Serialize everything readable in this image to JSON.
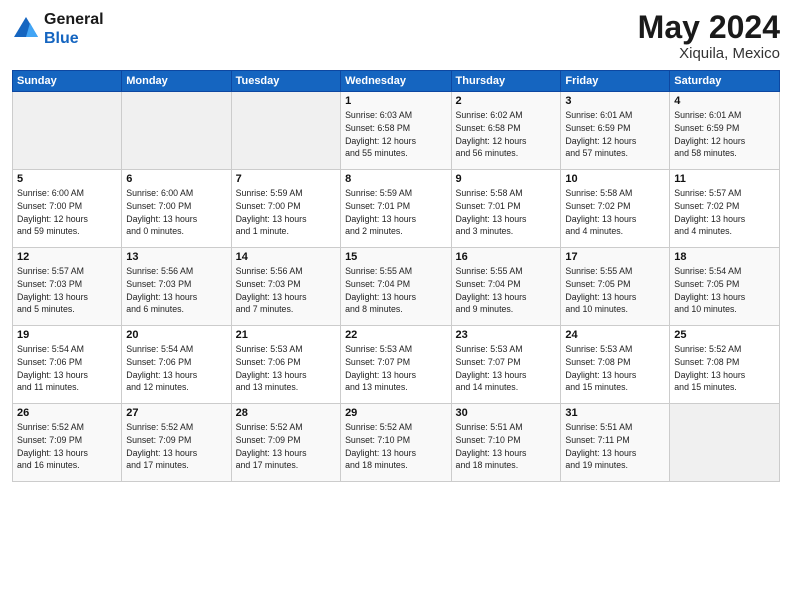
{
  "logo": {
    "line1": "General",
    "line2": "Blue"
  },
  "title": "May 2024",
  "location": "Xiquila, Mexico",
  "days_header": [
    "Sunday",
    "Monday",
    "Tuesday",
    "Wednesday",
    "Thursday",
    "Friday",
    "Saturday"
  ],
  "weeks": [
    [
      {
        "num": "",
        "info": ""
      },
      {
        "num": "",
        "info": ""
      },
      {
        "num": "",
        "info": ""
      },
      {
        "num": "1",
        "info": "Sunrise: 6:03 AM\nSunset: 6:58 PM\nDaylight: 12 hours\nand 55 minutes."
      },
      {
        "num": "2",
        "info": "Sunrise: 6:02 AM\nSunset: 6:58 PM\nDaylight: 12 hours\nand 56 minutes."
      },
      {
        "num": "3",
        "info": "Sunrise: 6:01 AM\nSunset: 6:59 PM\nDaylight: 12 hours\nand 57 minutes."
      },
      {
        "num": "4",
        "info": "Sunrise: 6:01 AM\nSunset: 6:59 PM\nDaylight: 12 hours\nand 58 minutes."
      }
    ],
    [
      {
        "num": "5",
        "info": "Sunrise: 6:00 AM\nSunset: 7:00 PM\nDaylight: 12 hours\nand 59 minutes."
      },
      {
        "num": "6",
        "info": "Sunrise: 6:00 AM\nSunset: 7:00 PM\nDaylight: 13 hours\nand 0 minutes."
      },
      {
        "num": "7",
        "info": "Sunrise: 5:59 AM\nSunset: 7:00 PM\nDaylight: 13 hours\nand 1 minute."
      },
      {
        "num": "8",
        "info": "Sunrise: 5:59 AM\nSunset: 7:01 PM\nDaylight: 13 hours\nand 2 minutes."
      },
      {
        "num": "9",
        "info": "Sunrise: 5:58 AM\nSunset: 7:01 PM\nDaylight: 13 hours\nand 3 minutes."
      },
      {
        "num": "10",
        "info": "Sunrise: 5:58 AM\nSunset: 7:02 PM\nDaylight: 13 hours\nand 4 minutes."
      },
      {
        "num": "11",
        "info": "Sunrise: 5:57 AM\nSunset: 7:02 PM\nDaylight: 13 hours\nand 4 minutes."
      }
    ],
    [
      {
        "num": "12",
        "info": "Sunrise: 5:57 AM\nSunset: 7:03 PM\nDaylight: 13 hours\nand 5 minutes."
      },
      {
        "num": "13",
        "info": "Sunrise: 5:56 AM\nSunset: 7:03 PM\nDaylight: 13 hours\nand 6 minutes."
      },
      {
        "num": "14",
        "info": "Sunrise: 5:56 AM\nSunset: 7:03 PM\nDaylight: 13 hours\nand 7 minutes."
      },
      {
        "num": "15",
        "info": "Sunrise: 5:55 AM\nSunset: 7:04 PM\nDaylight: 13 hours\nand 8 minutes."
      },
      {
        "num": "16",
        "info": "Sunrise: 5:55 AM\nSunset: 7:04 PM\nDaylight: 13 hours\nand 9 minutes."
      },
      {
        "num": "17",
        "info": "Sunrise: 5:55 AM\nSunset: 7:05 PM\nDaylight: 13 hours\nand 10 minutes."
      },
      {
        "num": "18",
        "info": "Sunrise: 5:54 AM\nSunset: 7:05 PM\nDaylight: 13 hours\nand 10 minutes."
      }
    ],
    [
      {
        "num": "19",
        "info": "Sunrise: 5:54 AM\nSunset: 7:06 PM\nDaylight: 13 hours\nand 11 minutes."
      },
      {
        "num": "20",
        "info": "Sunrise: 5:54 AM\nSunset: 7:06 PM\nDaylight: 13 hours\nand 12 minutes."
      },
      {
        "num": "21",
        "info": "Sunrise: 5:53 AM\nSunset: 7:06 PM\nDaylight: 13 hours\nand 13 minutes."
      },
      {
        "num": "22",
        "info": "Sunrise: 5:53 AM\nSunset: 7:07 PM\nDaylight: 13 hours\nand 13 minutes."
      },
      {
        "num": "23",
        "info": "Sunrise: 5:53 AM\nSunset: 7:07 PM\nDaylight: 13 hours\nand 14 minutes."
      },
      {
        "num": "24",
        "info": "Sunrise: 5:53 AM\nSunset: 7:08 PM\nDaylight: 13 hours\nand 15 minutes."
      },
      {
        "num": "25",
        "info": "Sunrise: 5:52 AM\nSunset: 7:08 PM\nDaylight: 13 hours\nand 15 minutes."
      }
    ],
    [
      {
        "num": "26",
        "info": "Sunrise: 5:52 AM\nSunset: 7:09 PM\nDaylight: 13 hours\nand 16 minutes."
      },
      {
        "num": "27",
        "info": "Sunrise: 5:52 AM\nSunset: 7:09 PM\nDaylight: 13 hours\nand 17 minutes."
      },
      {
        "num": "28",
        "info": "Sunrise: 5:52 AM\nSunset: 7:09 PM\nDaylight: 13 hours\nand 17 minutes."
      },
      {
        "num": "29",
        "info": "Sunrise: 5:52 AM\nSunset: 7:10 PM\nDaylight: 13 hours\nand 18 minutes."
      },
      {
        "num": "30",
        "info": "Sunrise: 5:51 AM\nSunset: 7:10 PM\nDaylight: 13 hours\nand 18 minutes."
      },
      {
        "num": "31",
        "info": "Sunrise: 5:51 AM\nSunset: 7:11 PM\nDaylight: 13 hours\nand 19 minutes."
      },
      {
        "num": "",
        "info": ""
      }
    ]
  ]
}
